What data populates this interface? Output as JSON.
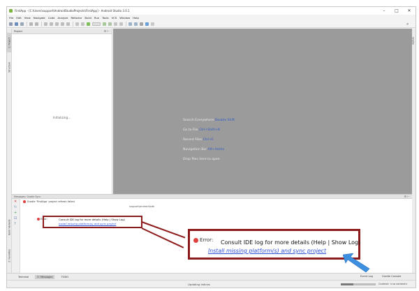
{
  "window": {
    "title": "FirstApp - [C:\\Users\\support\\AndroidStudioProjects\\FirstApp] - Android Studio 3.0.1",
    "minimize": "–",
    "maximize": "□",
    "close": "✕"
  },
  "menu": [
    "File",
    "Edit",
    "View",
    "Navigate",
    "Code",
    "Analyze",
    "Refactor",
    "Build",
    "Run",
    "Tools",
    "VCS",
    "Window",
    "Help"
  ],
  "left_tool_tabs": [
    "1: Project",
    "Structure"
  ],
  "right_tool_tabs": [
    "Gradle"
  ],
  "project_panel": {
    "header": "Project",
    "icons": "⚙ ⊢",
    "status": "Initializing..."
  },
  "editor_hints": {
    "search_label": "Search Everywhere",
    "search_key": "Double Shift",
    "goto_label": "Go to File",
    "goto_key": "Ctrl+Shift+N",
    "recent_label": "Recent Files",
    "recent_key": "Ctrl+E",
    "nav_label": "Navigation Bar",
    "nav_key": "Alt+Home",
    "drop_text": "Drop files here to open"
  },
  "messages": {
    "header": "Messages: Gradle Sync",
    "header_icons": "⚙ ⊢",
    "tree_title": "Gradle 'FirstApp' project refresh failed",
    "tree_path": "support\\android\\sdk",
    "error_label": "Error:",
    "error_text": "Consult IDE log for more details (Help | Show Log)",
    "error_link": "Install missing platform(s) and sync project"
  },
  "callout": {
    "error_label": "Error:",
    "error_text": "Consult IDE log for more details (Help | Show Log)",
    "error_link": "Install missing platform(s) and sync project"
  },
  "bottom_tabs": {
    "terminal": "Terminal",
    "messages": "0: Messages",
    "todo": "TODO",
    "event_log": "Event Log",
    "gradle_console": "Gradle Console"
  },
  "side_bottom_tabs": [
    "Build Variants",
    "2: Favorites"
  ],
  "status": {
    "center": "Updating Indices",
    "progress": 0.35,
    "right": "Context: <no context>"
  },
  "colors": {
    "highlight": "#8e1b1b",
    "link": "#2b4fd6",
    "editor_bg": "#9b9b9b",
    "key_hint": "#2e5cc8",
    "arrow": "#3d8fe0"
  }
}
